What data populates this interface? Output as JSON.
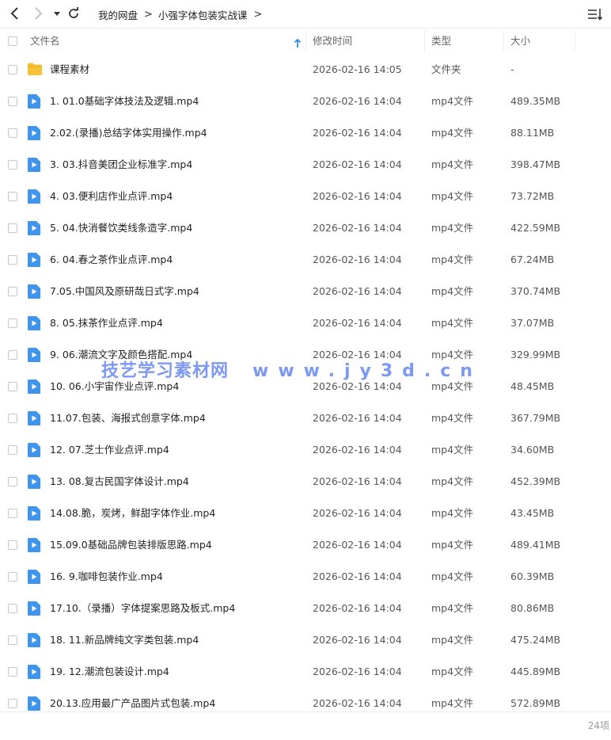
{
  "breadcrumb": [
    "我的网盘",
    "小强字体包装实战课"
  ],
  "columns": {
    "name": "文件名",
    "modified": "修改时间",
    "type": "类型",
    "size": "大小"
  },
  "icons": {
    "back": "back-arrow-icon",
    "forward": "forward-arrow-icon",
    "history": "dropdown-caret-icon",
    "refresh": "refresh-icon",
    "sort": "sort-list-icon",
    "sort_indicator": "sort-up-arrow-icon",
    "folder": "folder-icon",
    "video": "video-file-icon"
  },
  "colors": {
    "accent": "#2f8ff0",
    "folder": "#f7c236",
    "video": "#3e95ee"
  },
  "files": [
    {
      "name": "课程素材",
      "modified": "2026-02-16 14:05",
      "type": "文件夹",
      "size": "-",
      "kind": "folder"
    },
    {
      "name": "1. 01.0基础字体技法及逻辑.mp4",
      "modified": "2026-02-16 14:04",
      "type": "mp4文件",
      "size": "489.35MB",
      "kind": "video"
    },
    {
      "name": "2.02.(录播)总结字体实用操作.mp4",
      "modified": "2026-02-16 14:04",
      "type": "mp4文件",
      "size": "88.11MB",
      "kind": "video"
    },
    {
      "name": "3. 03.抖音美团企业标准字.mp4",
      "modified": "2026-02-16 14:04",
      "type": "mp4文件",
      "size": "398.47MB",
      "kind": "video"
    },
    {
      "name": "4. 03.便利店作业点评.mp4",
      "modified": "2026-02-16 14:04",
      "type": "mp4文件",
      "size": "73.72MB",
      "kind": "video"
    },
    {
      "name": "5. 04.快消餐饮类线条造字.mp4",
      "modified": "2026-02-16 14:04",
      "type": "mp4文件",
      "size": "422.59MB",
      "kind": "video"
    },
    {
      "name": "6. 04.春之茶作业点评.mp4",
      "modified": "2026-02-16 14:04",
      "type": "mp4文件",
      "size": "67.24MB",
      "kind": "video"
    },
    {
      "name": "7.05.中国风及原研哉日式字.mp4",
      "modified": "2026-02-16 14:04",
      "type": "mp4文件",
      "size": "370.74MB",
      "kind": "video"
    },
    {
      "name": "8. 05.抹茶作业点评.mp4",
      "modified": "2026-02-16 14:04",
      "type": "mp4文件",
      "size": "37.07MB",
      "kind": "video"
    },
    {
      "name": "9. 06.潮流文字及颜色搭配.mp4",
      "modified": "2026-02-16 14:04",
      "type": "mp4文件",
      "size": "329.99MB",
      "kind": "video"
    },
    {
      "name": "10. 06.小宇宙作业点评.mp4",
      "modified": "2026-02-16 14:04",
      "type": "mp4文件",
      "size": "48.45MB",
      "kind": "video"
    },
    {
      "name": "11.07.包装、海报式创意字体.mp4",
      "modified": "2026-02-16 14:04",
      "type": "mp4文件",
      "size": "367.79MB",
      "kind": "video"
    },
    {
      "name": "12. 07.芝士作业点评.mp4",
      "modified": "2026-02-16 14:04",
      "type": "mp4文件",
      "size": "34.60MB",
      "kind": "video"
    },
    {
      "name": "13. 08.复古民国字体设计.mp4",
      "modified": "2026-02-16 14:04",
      "type": "mp4文件",
      "size": "452.39MB",
      "kind": "video"
    },
    {
      "name": "14.08.脆，炭烤，鲜甜字体作业.mp4",
      "modified": "2026-02-16 14:04",
      "type": "mp4文件",
      "size": "43.45MB",
      "kind": "video"
    },
    {
      "name": "15.09.0基础品牌包装排版思路.mp4",
      "modified": "2026-02-16 14:04",
      "type": "mp4文件",
      "size": "489.41MB",
      "kind": "video"
    },
    {
      "name": "16. 9.咖啡包装作业.mp4",
      "modified": "2026-02-16 14:04",
      "type": "mp4文件",
      "size": "60.39MB",
      "kind": "video"
    },
    {
      "name": "17.10.（录播）字体提案思路及板式.mp4",
      "modified": "2026-02-16 14:04",
      "type": "mp4文件",
      "size": "80.86MB",
      "kind": "video"
    },
    {
      "name": "18. 11.新品牌纯文字类包装.mp4",
      "modified": "2026-02-16 14:04",
      "type": "mp4文件",
      "size": "475.24MB",
      "kind": "video"
    },
    {
      "name": "19. 12.潮流包装设计.mp4",
      "modified": "2026-02-16 14:04",
      "type": "mp4文件",
      "size": "445.89MB",
      "kind": "video"
    },
    {
      "name": "20.13.应用最广产品图片式包装.mp4",
      "modified": "2026-02-16 14:04",
      "type": "mp4文件",
      "size": "572.89MB",
      "kind": "video"
    }
  ],
  "footer": {
    "count": "24项"
  },
  "watermark": {
    "text": "技艺学习素材网",
    "url": "www.jy3d.cn"
  }
}
